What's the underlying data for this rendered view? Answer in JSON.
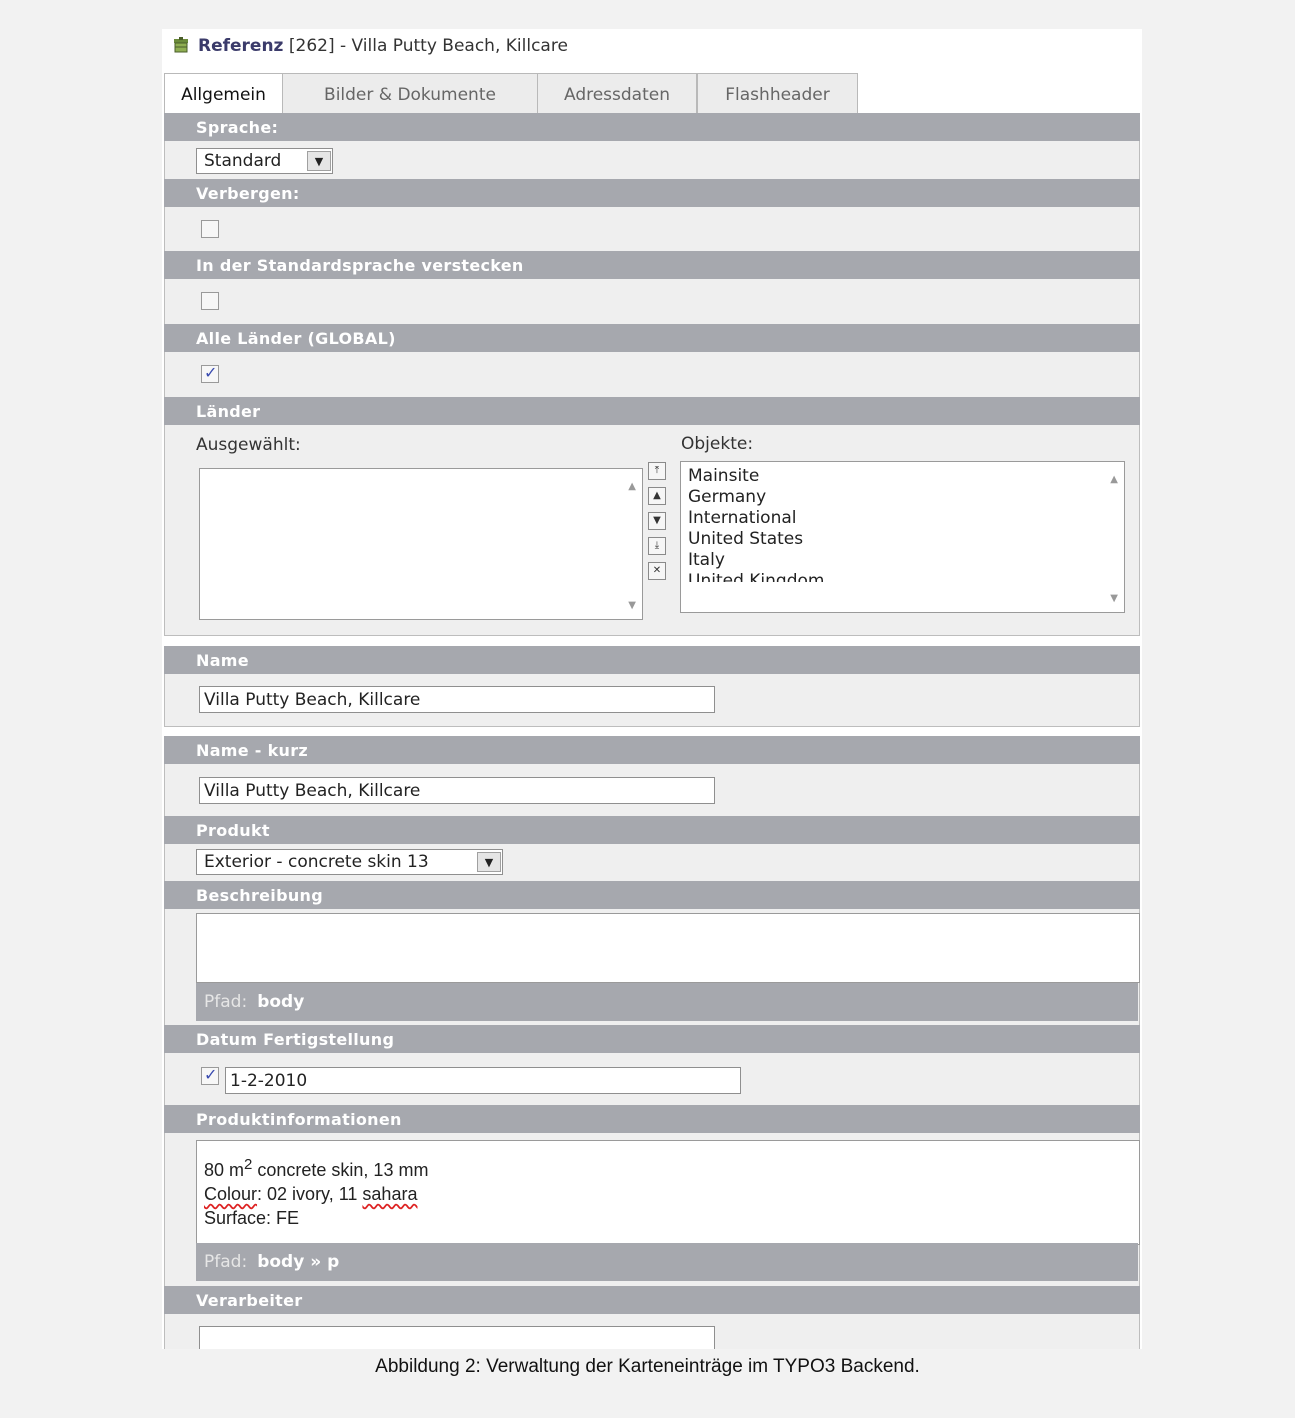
{
  "record": {
    "type_label": "Referenz",
    "rest_label": "[262] - Villa Putty Beach, Killcare"
  },
  "tabs": [
    "Allgemein",
    "Bilder & Dokumente",
    "Adressdaten",
    "Flashheader"
  ],
  "sprache": {
    "label": "Sprache:",
    "value": "Standard"
  },
  "verbergen": {
    "label": "Verbergen:",
    "checked": false
  },
  "standard_verstecken": {
    "label": "In der Standardsprache verstecken",
    "checked": false
  },
  "alle_laender": {
    "label": "Alle Länder (GLOBAL)",
    "checked": true
  },
  "laender": {
    "label": "Länder",
    "selected_label": "Ausgewählt:",
    "objects_label": "Objekte:",
    "objects": [
      "Mainsite",
      "Germany",
      "International",
      "United States",
      "Italy",
      "United Kingdom"
    ]
  },
  "name": {
    "label": "Name",
    "value": "Villa Putty Beach, Killcare"
  },
  "name_kurz": {
    "label": "Name - kurz",
    "value": "Villa Putty Beach, Killcare"
  },
  "produkt": {
    "label": "Produkt",
    "value": "Exterior - concrete skin 13"
  },
  "beschreibung": {
    "label": "Beschreibung",
    "path_label": "Pfad:",
    "path": "body"
  },
  "datum": {
    "label": "Datum Fertigstellung",
    "checked": true,
    "value": "1-2-2010"
  },
  "produktinformationen": {
    "label": "Produktinformationen",
    "line1_pre": "80 m",
    "line1_sup": "2",
    "line1_post": " concrete skin, 13 mm",
    "line2_word": "Colour",
    "line2_mid": ": 02 ivory, 11 ",
    "line2_word2": "sahara",
    "line3": "Surface: FE",
    "path_label": "Pfad:",
    "path": "body » p"
  },
  "verarbeiter": {
    "label": "Verarbeiter",
    "value": ""
  },
  "caption": "Abbildung 2: Verwaltung der Karteneinträge im TYPO3 Backend."
}
